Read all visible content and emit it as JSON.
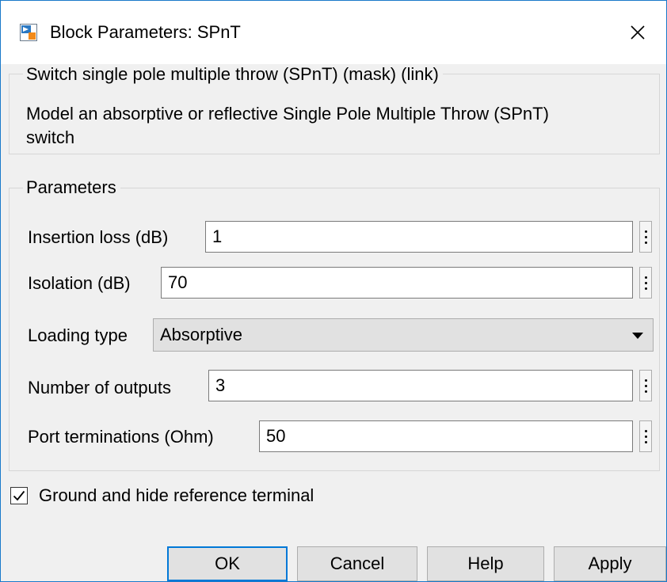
{
  "window": {
    "title": "Block Parameters: SPnT",
    "icons": {
      "app": "simulink-block-icon",
      "close": "close-icon"
    }
  },
  "description": {
    "group_title": "Switch single pole multiple throw (SPnT) (mask) (link)",
    "line1": "Model an absorptive or reflective Single Pole Multiple Throw (SPnT)",
    "line2": "switch"
  },
  "parameters": {
    "group_title": "Parameters",
    "insertion_loss": {
      "label": "Insertion loss (dB)",
      "value": "1"
    },
    "isolation": {
      "label": "Isolation (dB)",
      "value": "70"
    },
    "loading_type": {
      "label": "Loading type",
      "value": "Absorptive"
    },
    "num_outputs": {
      "label": "Number of outputs",
      "value": "3"
    },
    "port_terminations": {
      "label": "Port terminations (Ohm)",
      "value": "50"
    }
  },
  "ground": {
    "label": "Ground and hide reference terminal",
    "checked": true
  },
  "buttons": {
    "ok": "OK",
    "cancel": "Cancel",
    "help": "Help",
    "apply": "Apply"
  },
  "colors": {
    "accent": "#0078d7",
    "window_border": "#1979ca",
    "background": "#f0f0f0"
  }
}
